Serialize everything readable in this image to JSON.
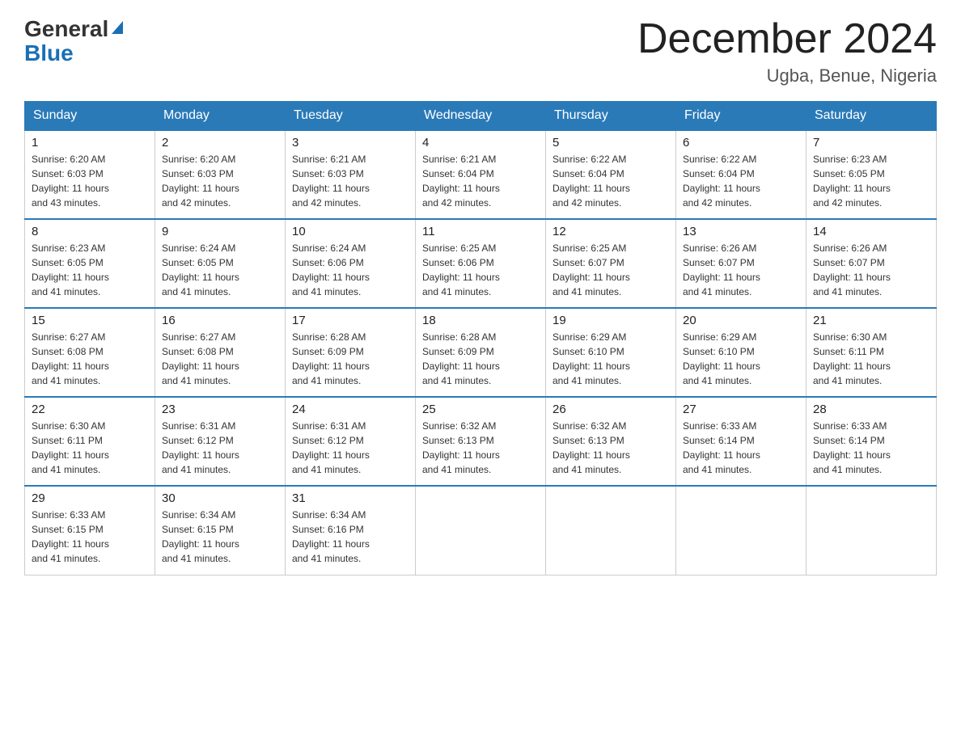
{
  "header": {
    "logo_general": "General",
    "logo_blue": "Blue",
    "month_title": "December 2024",
    "location": "Ugba, Benue, Nigeria"
  },
  "days_of_week": [
    "Sunday",
    "Monday",
    "Tuesday",
    "Wednesday",
    "Thursday",
    "Friday",
    "Saturday"
  ],
  "weeks": [
    [
      {
        "day": "1",
        "sunrise": "6:20 AM",
        "sunset": "6:03 PM",
        "daylight": "11 hours and 43 minutes."
      },
      {
        "day": "2",
        "sunrise": "6:20 AM",
        "sunset": "6:03 PM",
        "daylight": "11 hours and 42 minutes."
      },
      {
        "day": "3",
        "sunrise": "6:21 AM",
        "sunset": "6:03 PM",
        "daylight": "11 hours and 42 minutes."
      },
      {
        "day": "4",
        "sunrise": "6:21 AM",
        "sunset": "6:04 PM",
        "daylight": "11 hours and 42 minutes."
      },
      {
        "day": "5",
        "sunrise": "6:22 AM",
        "sunset": "6:04 PM",
        "daylight": "11 hours and 42 minutes."
      },
      {
        "day": "6",
        "sunrise": "6:22 AM",
        "sunset": "6:04 PM",
        "daylight": "11 hours and 42 minutes."
      },
      {
        "day": "7",
        "sunrise": "6:23 AM",
        "sunset": "6:05 PM",
        "daylight": "11 hours and 42 minutes."
      }
    ],
    [
      {
        "day": "8",
        "sunrise": "6:23 AM",
        "sunset": "6:05 PM",
        "daylight": "11 hours and 41 minutes."
      },
      {
        "day": "9",
        "sunrise": "6:24 AM",
        "sunset": "6:05 PM",
        "daylight": "11 hours and 41 minutes."
      },
      {
        "day": "10",
        "sunrise": "6:24 AM",
        "sunset": "6:06 PM",
        "daylight": "11 hours and 41 minutes."
      },
      {
        "day": "11",
        "sunrise": "6:25 AM",
        "sunset": "6:06 PM",
        "daylight": "11 hours and 41 minutes."
      },
      {
        "day": "12",
        "sunrise": "6:25 AM",
        "sunset": "6:07 PM",
        "daylight": "11 hours and 41 minutes."
      },
      {
        "day": "13",
        "sunrise": "6:26 AM",
        "sunset": "6:07 PM",
        "daylight": "11 hours and 41 minutes."
      },
      {
        "day": "14",
        "sunrise": "6:26 AM",
        "sunset": "6:07 PM",
        "daylight": "11 hours and 41 minutes."
      }
    ],
    [
      {
        "day": "15",
        "sunrise": "6:27 AM",
        "sunset": "6:08 PM",
        "daylight": "11 hours and 41 minutes."
      },
      {
        "day": "16",
        "sunrise": "6:27 AM",
        "sunset": "6:08 PM",
        "daylight": "11 hours and 41 minutes."
      },
      {
        "day": "17",
        "sunrise": "6:28 AM",
        "sunset": "6:09 PM",
        "daylight": "11 hours and 41 minutes."
      },
      {
        "day": "18",
        "sunrise": "6:28 AM",
        "sunset": "6:09 PM",
        "daylight": "11 hours and 41 minutes."
      },
      {
        "day": "19",
        "sunrise": "6:29 AM",
        "sunset": "6:10 PM",
        "daylight": "11 hours and 41 minutes."
      },
      {
        "day": "20",
        "sunrise": "6:29 AM",
        "sunset": "6:10 PM",
        "daylight": "11 hours and 41 minutes."
      },
      {
        "day": "21",
        "sunrise": "6:30 AM",
        "sunset": "6:11 PM",
        "daylight": "11 hours and 41 minutes."
      }
    ],
    [
      {
        "day": "22",
        "sunrise": "6:30 AM",
        "sunset": "6:11 PM",
        "daylight": "11 hours and 41 minutes."
      },
      {
        "day": "23",
        "sunrise": "6:31 AM",
        "sunset": "6:12 PM",
        "daylight": "11 hours and 41 minutes."
      },
      {
        "day": "24",
        "sunrise": "6:31 AM",
        "sunset": "6:12 PM",
        "daylight": "11 hours and 41 minutes."
      },
      {
        "day": "25",
        "sunrise": "6:32 AM",
        "sunset": "6:13 PM",
        "daylight": "11 hours and 41 minutes."
      },
      {
        "day": "26",
        "sunrise": "6:32 AM",
        "sunset": "6:13 PM",
        "daylight": "11 hours and 41 minutes."
      },
      {
        "day": "27",
        "sunrise": "6:33 AM",
        "sunset": "6:14 PM",
        "daylight": "11 hours and 41 minutes."
      },
      {
        "day": "28",
        "sunrise": "6:33 AM",
        "sunset": "6:14 PM",
        "daylight": "11 hours and 41 minutes."
      }
    ],
    [
      {
        "day": "29",
        "sunrise": "6:33 AM",
        "sunset": "6:15 PM",
        "daylight": "11 hours and 41 minutes."
      },
      {
        "day": "30",
        "sunrise": "6:34 AM",
        "sunset": "6:15 PM",
        "daylight": "11 hours and 41 minutes."
      },
      {
        "day": "31",
        "sunrise": "6:34 AM",
        "sunset": "6:16 PM",
        "daylight": "11 hours and 41 minutes."
      },
      null,
      null,
      null,
      null
    ]
  ],
  "labels": {
    "sunrise": "Sunrise:",
    "sunset": "Sunset:",
    "daylight": "Daylight:"
  }
}
